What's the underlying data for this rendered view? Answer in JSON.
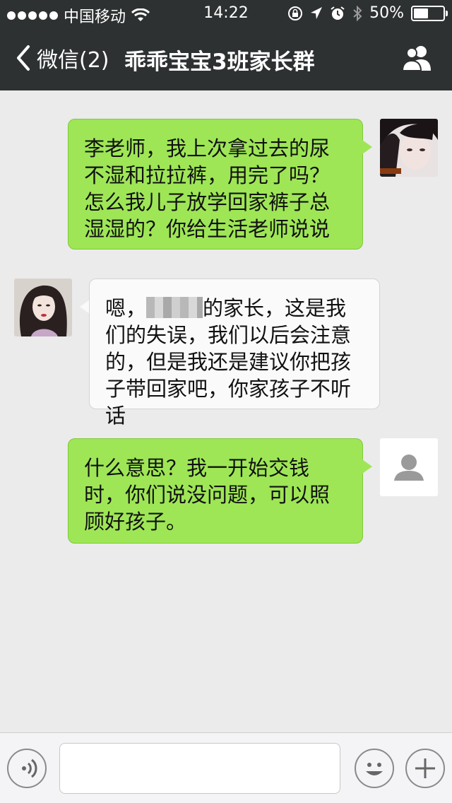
{
  "status_bar": {
    "carrier": "中国移动",
    "time": "14:22",
    "battery_text": "50%",
    "battery_level": 0.5
  },
  "nav": {
    "back_label": "微信(2)",
    "title": "乖乖宝宝3班家长群"
  },
  "messages": [
    {
      "direction": "outgoing",
      "text": "李老师，我上次拿过去的尿不湿和拉拉裤，用完了吗？怎么我儿子放学回家裤子总湿湿的？你给生活老师说说"
    },
    {
      "direction": "incoming",
      "text_before_redaction": "嗯，",
      "text_after_redaction": "的家长，这是我们的失误，我们以后会注意的，但是我还是建议你把孩子带回家吧，你家孩子不听话"
    },
    {
      "direction": "outgoing",
      "text": "什么意思？我一开始交钱时，你们说没问题，可以照顾好孩子。"
    }
  ],
  "colors": {
    "nav_bg": "#2e3132",
    "outgoing_bubble": "#9ee656",
    "incoming_bubble": "#fafafa",
    "chat_bg": "#ebebeb"
  },
  "icons": [
    "wifi-icon",
    "lock-rotation-icon",
    "location-arrow-icon",
    "alarm-icon",
    "bluetooth-icon",
    "back-chevron-icon",
    "group-members-icon",
    "voice-icon",
    "emoji-icon",
    "plus-icon"
  ]
}
